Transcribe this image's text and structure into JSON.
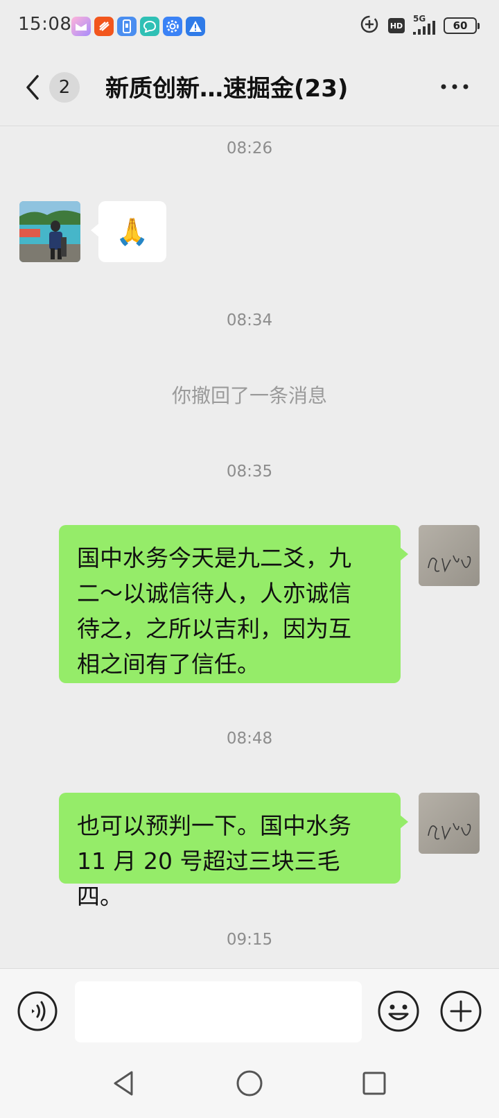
{
  "status_bar": {
    "time": "15:08",
    "notification_icons": [
      {
        "name": "mail-app-icon",
        "color": "#b98cf5"
      },
      {
        "name": "news-app-icon",
        "color": "#f2561d"
      },
      {
        "name": "phone-manager-icon",
        "color": "#4a8ef0"
      },
      {
        "name": "chat-bubble-app-icon",
        "color": "#2fc0b5"
      },
      {
        "name": "settings-app-icon",
        "color": "#3b82f6"
      },
      {
        "name": "warning-app-icon",
        "color": "#2f7be8"
      }
    ],
    "network": "5G",
    "hd_label": "HD",
    "battery_level": "60"
  },
  "header": {
    "unread_count": "2",
    "title": "新质创新…速掘金(23)"
  },
  "messages": [
    {
      "type": "time",
      "text": "08:26"
    },
    {
      "type": "incoming",
      "text": "🙏"
    },
    {
      "type": "time",
      "text": "08:34"
    },
    {
      "type": "system",
      "text": "你撤回了一条消息"
    },
    {
      "type": "time",
      "text": "08:35"
    },
    {
      "type": "outgoing",
      "lines": [
        "国中水务今天是九二爻，九",
        "二～以诚信待人，人亦诚信",
        "待之，之所以吉利，因为互",
        "相之间有了信任。"
      ]
    },
    {
      "type": "time",
      "text": "08:48"
    },
    {
      "type": "outgoing",
      "lines": [
        "也可以预判一下。国中水务",
        "11 月 20 号超过三块三毛四。"
      ]
    },
    {
      "type": "time",
      "text": "09:15"
    }
  ],
  "input": {
    "value": "",
    "placeholder": ""
  },
  "colors": {
    "background": "#ededed",
    "outgoing_bubble": "#95ec69",
    "incoming_bubble": "#ffffff"
  }
}
